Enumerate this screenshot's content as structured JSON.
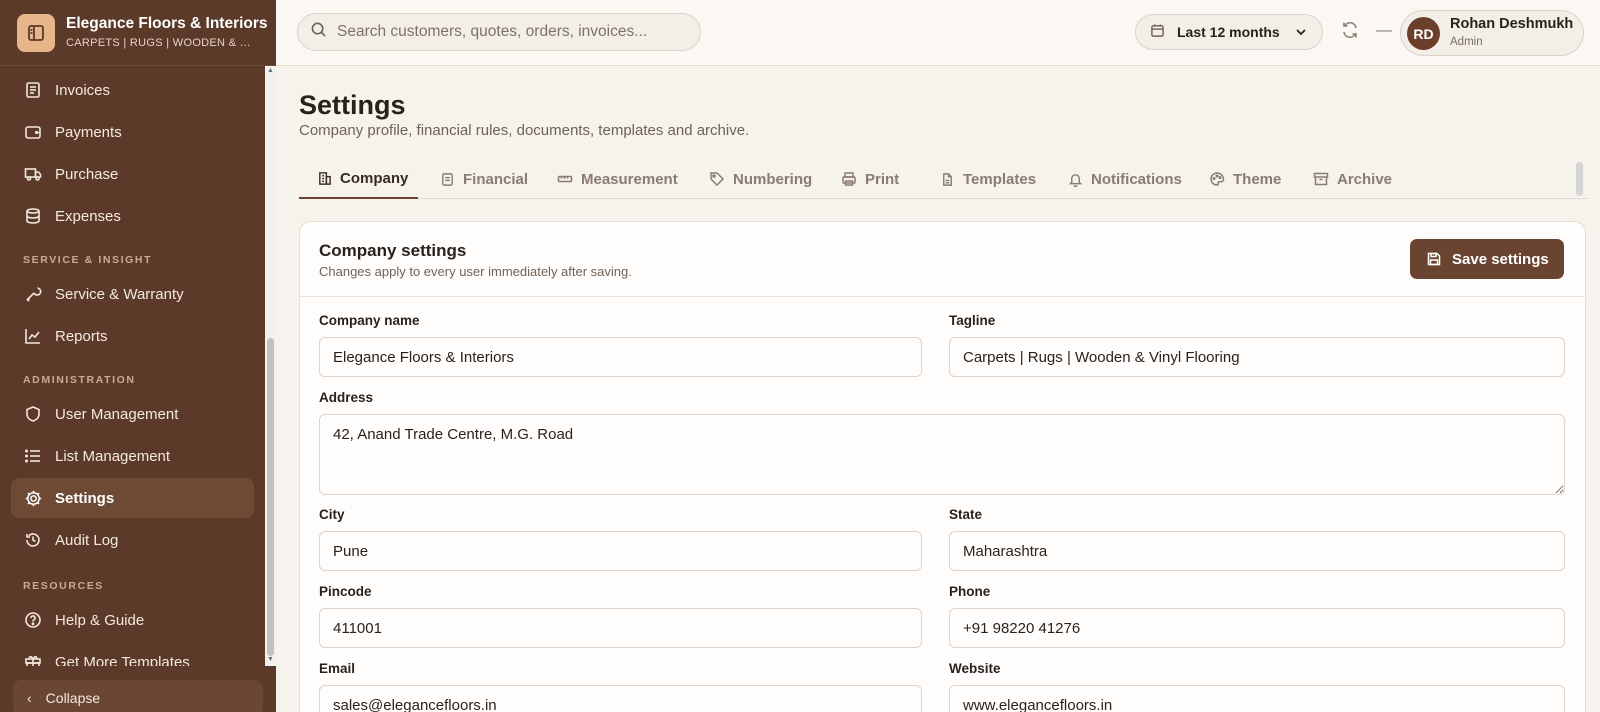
{
  "brand": {
    "name": "Elegance Floors & Interiors",
    "tagline": "CARPETS | RUGS | WOODEN & VINYL FLOORING"
  },
  "sidebar": {
    "items": [
      {
        "label": "Invoices",
        "icon": "invoice-icon"
      },
      {
        "label": "Payments",
        "icon": "wallet-icon"
      },
      {
        "label": "Purchase",
        "icon": "truck-icon"
      },
      {
        "label": "Expenses",
        "icon": "database-icon"
      },
      {
        "label": "Service & Warranty",
        "icon": "wrench-icon"
      },
      {
        "label": "Reports",
        "icon": "chart-line-icon"
      },
      {
        "label": "User Management",
        "icon": "shield-icon"
      },
      {
        "label": "List Management",
        "icon": "list-icon"
      },
      {
        "label": "Settings",
        "icon": "gear-icon",
        "active": true
      },
      {
        "label": "Audit Log",
        "icon": "history-icon"
      },
      {
        "label": "Help & Guide",
        "icon": "help-circle-icon"
      },
      {
        "label": "Get More Templates",
        "icon": "gift-icon"
      }
    ],
    "sections": {
      "service": "SERVICE & INSIGHT",
      "admin": "ADMINISTRATION",
      "resources": "RESOURCES"
    },
    "collapse_label": "Collapse"
  },
  "topbar": {
    "search_placeholder": "Search customers, quotes, orders, invoices...",
    "period": "Last 12 months",
    "user": {
      "initials": "RD",
      "name": "Rohan Deshmukh",
      "role": "Admin"
    }
  },
  "page": {
    "title": "Settings",
    "subtitle": "Company profile, financial rules, documents, templates and archive."
  },
  "tabs": [
    {
      "label": "Company",
      "icon": "building-icon",
      "active": true
    },
    {
      "label": "Financial",
      "icon": "receipt-icon"
    },
    {
      "label": "Measurement",
      "icon": "ruler-icon"
    },
    {
      "label": "Numbering",
      "icon": "tag-icon"
    },
    {
      "label": "Print",
      "icon": "printer-icon"
    },
    {
      "label": "Templates",
      "icon": "file-icon"
    },
    {
      "label": "Notifications",
      "icon": "bell-icon"
    },
    {
      "label": "Theme",
      "icon": "palette-icon"
    },
    {
      "label": "Archive",
      "icon": "archive-icon"
    }
  ],
  "card": {
    "title": "Company settings",
    "subtitle": "Changes apply to every user immediately after saving.",
    "save_label": "Save settings"
  },
  "form": {
    "company_name": {
      "label": "Company name",
      "value": "Elegance Floors & Interiors"
    },
    "tagline": {
      "label": "Tagline",
      "value": "Carpets | Rugs | Wooden & Vinyl Flooring"
    },
    "address": {
      "label": "Address",
      "value": "42, Anand Trade Centre, M.G. Road"
    },
    "city": {
      "label": "City",
      "value": "Pune"
    },
    "state": {
      "label": "State",
      "value": "Maharashtra"
    },
    "pincode": {
      "label": "Pincode",
      "value": "411001"
    },
    "phone": {
      "label": "Phone",
      "value": "+91 98220 41276"
    },
    "email": {
      "label": "Email",
      "value": "sales@elegancefloors.in"
    },
    "website": {
      "label": "Website",
      "value": "www.elegancefloors.in"
    }
  },
  "colors": {
    "sidebar_bg": "#5b3a29",
    "accent": "#6b4431",
    "page_bg": "#f6f2ec"
  }
}
